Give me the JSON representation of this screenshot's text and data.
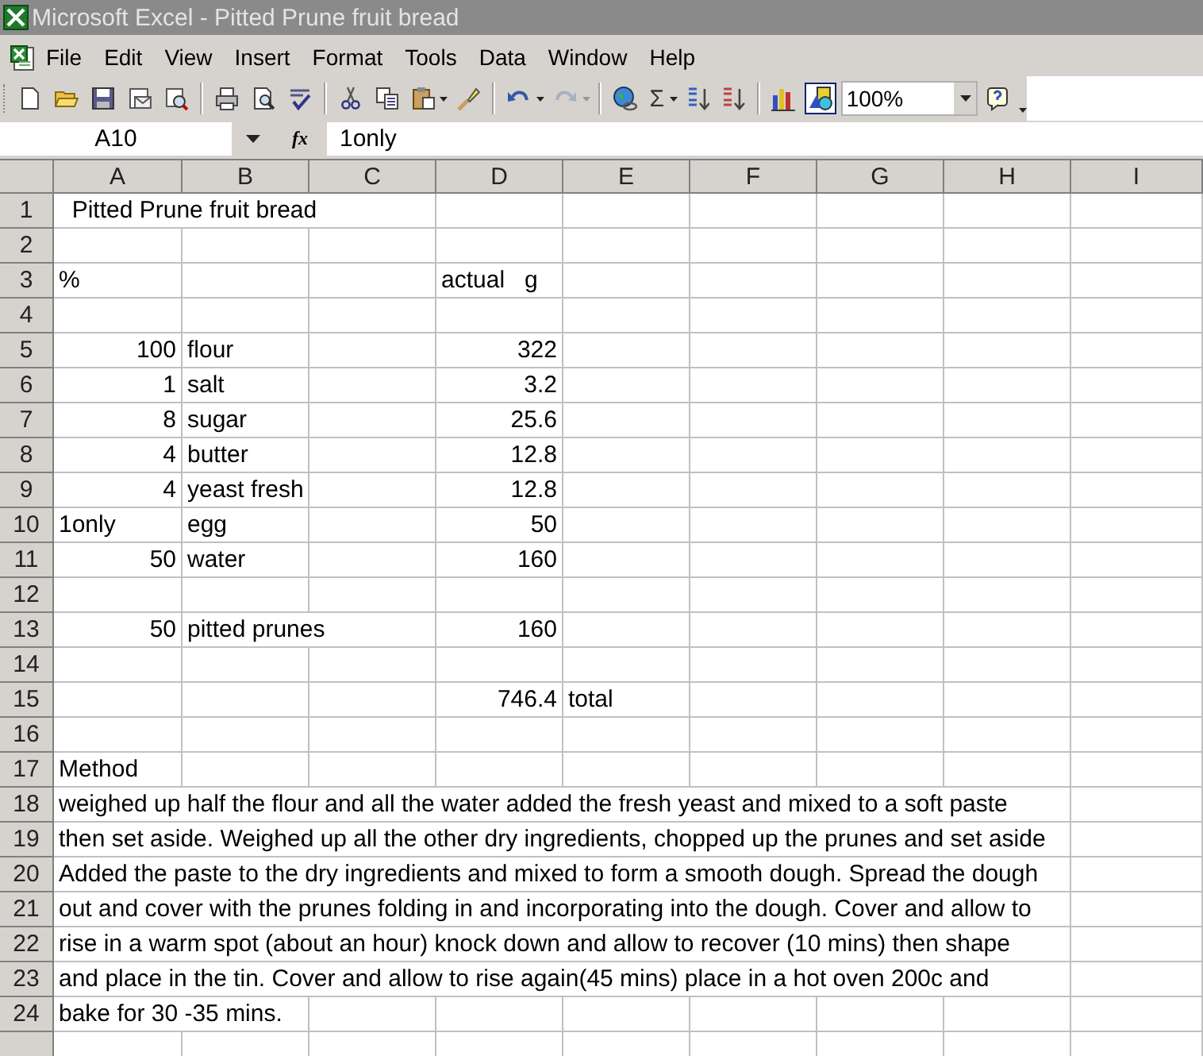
{
  "window": {
    "title": "Microsoft Excel - Pitted Prune fruit bread"
  },
  "menu": [
    "File",
    "Edit",
    "View",
    "Insert",
    "Format",
    "Tools",
    "Data",
    "Window",
    "Help"
  ],
  "toolbar": {
    "autosum_symbol": "Σ",
    "zoom": "100%"
  },
  "formula_bar": {
    "name_box": "A10",
    "function_label": "fx",
    "value": "1only"
  },
  "sheet": {
    "columns": [
      "A",
      "B",
      "C",
      "D",
      "E",
      "F",
      "G",
      "H",
      "I"
    ],
    "rows": [
      {
        "number": "1",
        "cells": [
          {
            "text": "  Pitted Prune fruit bread",
            "kind": "text"
          },
          "",
          "",
          "",
          "",
          "",
          "",
          "",
          ""
        ]
      },
      {
        "number": "2",
        "cells": [
          "",
          "",
          "",
          "",
          "",
          "",
          "",
          "",
          ""
        ]
      },
      {
        "number": "3",
        "cells": [
          {
            "text": "%",
            "kind": "text"
          },
          "",
          "",
          {
            "text": "actual   g",
            "kind": "text"
          },
          "",
          "",
          "",
          "",
          ""
        ]
      },
      {
        "number": "4",
        "cells": [
          "",
          "",
          "",
          "",
          "",
          "",
          "",
          "",
          ""
        ]
      },
      {
        "number": "5",
        "cells": [
          {
            "text": "100",
            "kind": "number"
          },
          {
            "text": "flour",
            "kind": "text"
          },
          "",
          {
            "text": "322",
            "kind": "number"
          },
          "",
          "",
          "",
          "",
          ""
        ]
      },
      {
        "number": "6",
        "cells": [
          {
            "text": "1",
            "kind": "number"
          },
          {
            "text": "salt",
            "kind": "text"
          },
          "",
          {
            "text": "3.2",
            "kind": "number"
          },
          "",
          "",
          "",
          "",
          ""
        ]
      },
      {
        "number": "7",
        "cells": [
          {
            "text": "8",
            "kind": "number"
          },
          {
            "text": "sugar",
            "kind": "text"
          },
          "",
          {
            "text": "25.6",
            "kind": "number"
          },
          "",
          "",
          "",
          "",
          ""
        ]
      },
      {
        "number": "8",
        "cells": [
          {
            "text": "4",
            "kind": "number"
          },
          {
            "text": "butter",
            "kind": "text"
          },
          "",
          {
            "text": "12.8",
            "kind": "number"
          },
          "",
          "",
          "",
          "",
          ""
        ]
      },
      {
        "number": "9",
        "cells": [
          {
            "text": "4",
            "kind": "number"
          },
          {
            "text": "yeast fresh",
            "kind": "text"
          },
          "",
          {
            "text": "12.8",
            "kind": "number"
          },
          "",
          "",
          "",
          "",
          ""
        ]
      },
      {
        "number": "10",
        "cells": [
          {
            "text": "1only",
            "kind": "text"
          },
          {
            "text": "egg",
            "kind": "text"
          },
          "",
          {
            "text": "50",
            "kind": "number"
          },
          "",
          "",
          "",
          "",
          ""
        ]
      },
      {
        "number": "11",
        "cells": [
          {
            "text": "50",
            "kind": "number"
          },
          {
            "text": "water",
            "kind": "text"
          },
          "",
          {
            "text": "160",
            "kind": "number"
          },
          "",
          "",
          "",
          "",
          ""
        ]
      },
      {
        "number": "12",
        "cells": [
          "",
          "",
          "",
          "",
          "",
          "",
          "",
          "",
          ""
        ]
      },
      {
        "number": "13",
        "cells": [
          {
            "text": "50",
            "kind": "number"
          },
          {
            "text": "pitted prunes",
            "kind": "text"
          },
          "",
          {
            "text": "160",
            "kind": "number"
          },
          "",
          "",
          "",
          "",
          ""
        ]
      },
      {
        "number": "14",
        "cells": [
          "",
          "",
          "",
          "",
          "",
          "",
          "",
          "",
          ""
        ]
      },
      {
        "number": "15",
        "cells": [
          "",
          "",
          "",
          {
            "text": "746.4",
            "kind": "number"
          },
          {
            "text": "total",
            "kind": "text"
          },
          "",
          "",
          "",
          ""
        ]
      },
      {
        "number": "16",
        "cells": [
          "",
          "",
          "",
          "",
          "",
          "",
          "",
          "",
          ""
        ]
      },
      {
        "number": "17",
        "cells": [
          {
            "text": "Method",
            "kind": "text"
          },
          "",
          "",
          "",
          "",
          "",
          "",
          "",
          ""
        ]
      },
      {
        "number": "18",
        "cells": [
          {
            "text": "weighed up half the flour and all the water added the fresh yeast and mixed to a soft paste",
            "kind": "text"
          },
          "",
          "",
          "",
          "",
          "",
          "",
          "",
          ""
        ]
      },
      {
        "number": "19",
        "cells": [
          {
            "text": "then set aside. Weighed up all the other dry ingredients, chopped up the prunes and set aside",
            "kind": "text"
          },
          "",
          "",
          "",
          "",
          "",
          "",
          "",
          ""
        ]
      },
      {
        "number": "20",
        "cells": [
          {
            "text": "Added the paste to the dry ingredients and mixed to form a smooth dough. Spread the dough",
            "kind": "text"
          },
          "",
          "",
          "",
          "",
          "",
          "",
          "",
          ""
        ]
      },
      {
        "number": "21",
        "cells": [
          {
            "text": "out and cover with the prunes folding in and incorporating into the dough. Cover and allow to",
            "kind": "text"
          },
          "",
          "",
          "",
          "",
          "",
          "",
          "",
          ""
        ]
      },
      {
        "number": "22",
        "cells": [
          {
            "text": "rise in a warm spot (about an hour) knock down and allow to recover (10 mins) then shape",
            "kind": "text"
          },
          "",
          "",
          "",
          "",
          "",
          "",
          "",
          ""
        ]
      },
      {
        "number": "23",
        "cells": [
          {
            "text": "and place in the tin. Cover and allow to rise again(45 mins) place in a hot oven 200c and",
            "kind": "text"
          },
          "",
          "",
          "",
          "",
          "",
          "",
          "",
          ""
        ]
      },
      {
        "number": "24",
        "cells": [
          {
            "text": "bake for 30 -35 mins.",
            "kind": "text"
          },
          "",
          "",
          "",
          "",
          "",
          "",
          "",
          ""
        ]
      },
      {
        "cells": [
          "",
          "",
          "",
          "",
          "",
          "",
          "",
          "",
          ""
        ]
      }
    ]
  }
}
